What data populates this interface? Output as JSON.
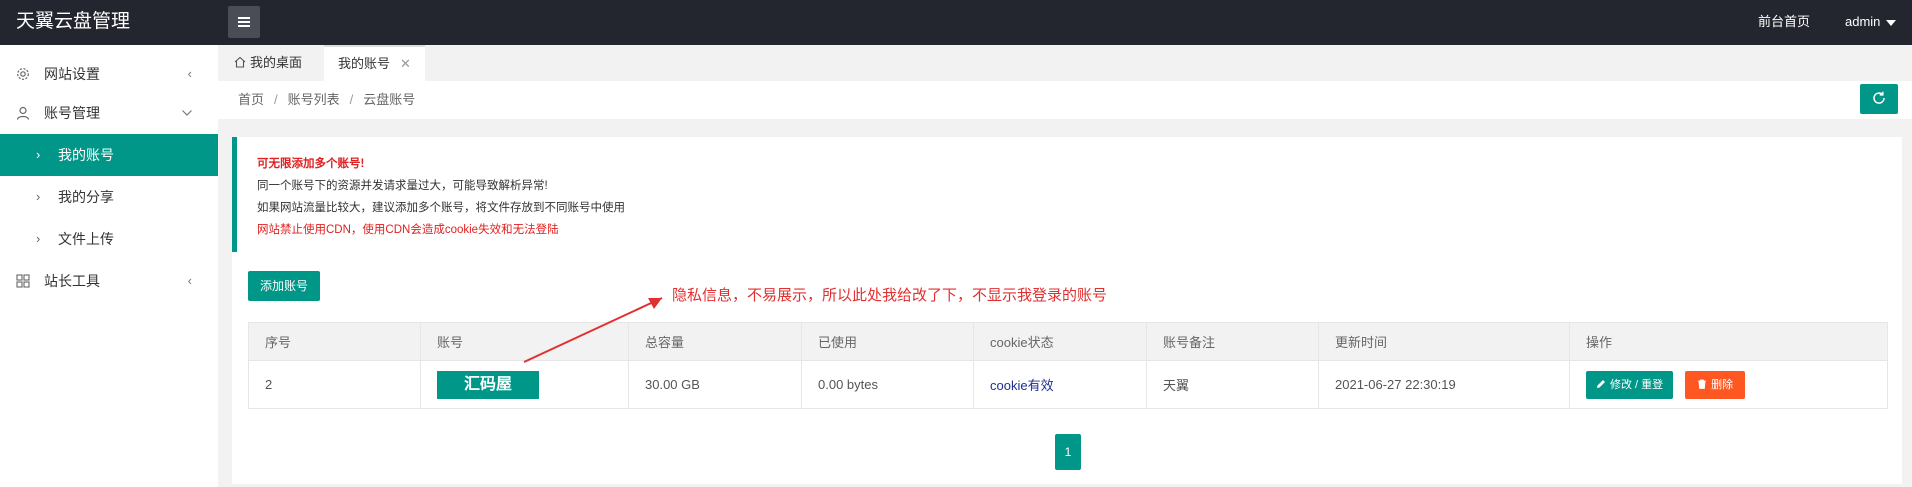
{
  "app": {
    "title": "天翼云盘管理"
  },
  "header": {
    "home_link": "前台首页",
    "user": "admin"
  },
  "sidebar": {
    "items": [
      {
        "label": "网站设置",
        "icon": "gear-icon"
      },
      {
        "label": "账号管理",
        "icon": "user-icon"
      },
      {
        "label": "站长工具",
        "icon": "grid-icon"
      }
    ],
    "sub_items": [
      {
        "label": "我的账号"
      },
      {
        "label": "我的分享"
      },
      {
        "label": "文件上传"
      }
    ]
  },
  "tabs": [
    {
      "label": "我的桌面",
      "icon": "home-icon"
    },
    {
      "label": "我的账号"
    }
  ],
  "breadcrumb": [
    "首页",
    "账号列表",
    "云盘账号"
  ],
  "notice": {
    "line1": "可无限添加多个账号!",
    "line2": "同一个账号下的资源并发请求量过大，可能导致解析异常!",
    "line3": "如果网站流量比较大，建议添加多个账号，将文件存放到不同账号中使用",
    "line4": "网站禁止使用CDN，使用CDN会造成cookie失效和无法登陆"
  },
  "toolbar": {
    "add_label": "添加账号"
  },
  "annotation": "隐私信息，不易展示，所以此处我给改了下，不显示我登录的账号",
  "table": {
    "headers": [
      "序号",
      "账号",
      "总容量",
      "已使用",
      "cookie状态",
      "账号备注",
      "更新时间",
      "操作"
    ],
    "rows": [
      {
        "id": "2",
        "account": "汇码屋",
        "capacity": "30.00 GB",
        "used": "0.00 bytes",
        "cookie": "cookie有效",
        "remark": "天翼",
        "updated": "2021-06-27 22:30:19",
        "edit_label": "修改 / 重登",
        "delete_label": "删除"
      }
    ]
  },
  "pagination": {
    "current": "1"
  },
  "colors": {
    "accent": "#009688",
    "danger": "#ff5722",
    "header_bg": "#23262e",
    "annotation": "#e03030"
  }
}
